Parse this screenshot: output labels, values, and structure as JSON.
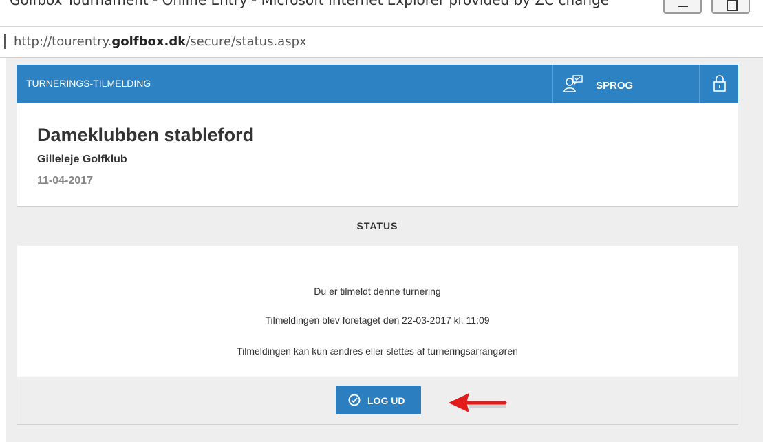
{
  "browser": {
    "window_title": "Golfbox Tournament - Online Entry - Microsoft Internet Explorer provided by ZC change",
    "url_prefix": "http://tourentry.",
    "url_domain": "golfbox.dk",
    "url_path": "/secure/status.aspx"
  },
  "header": {
    "title": "TURNERINGS-TILMELDING",
    "language_label": "SPROG",
    "language_icon": "user-chat-icon",
    "lock_icon": "lock-icon"
  },
  "tournament": {
    "name": "Dameklubben stableford",
    "club": "Gilleleje Golfklub",
    "date": "11-04-2017"
  },
  "status": {
    "heading": "STATUS",
    "messages": [
      "Du er tilmeldt denne turnering",
      "Tilmeldingen blev foretaget den 22-03-2017 kl. 11:09",
      "Tilmeldingen kan kun ændres eller slettes af turneringsarrangøren"
    ]
  },
  "footer": {
    "logout_label": "LOG UD",
    "logout_icon": "check-circle-icon",
    "annotation_icon": "red-arrow-icon"
  },
  "colors": {
    "header_blue": "#2d82c3",
    "button_blue": "#2b7fc0",
    "annotation_red": "#e21b1b",
    "panel_gray": "#eeeeee"
  }
}
